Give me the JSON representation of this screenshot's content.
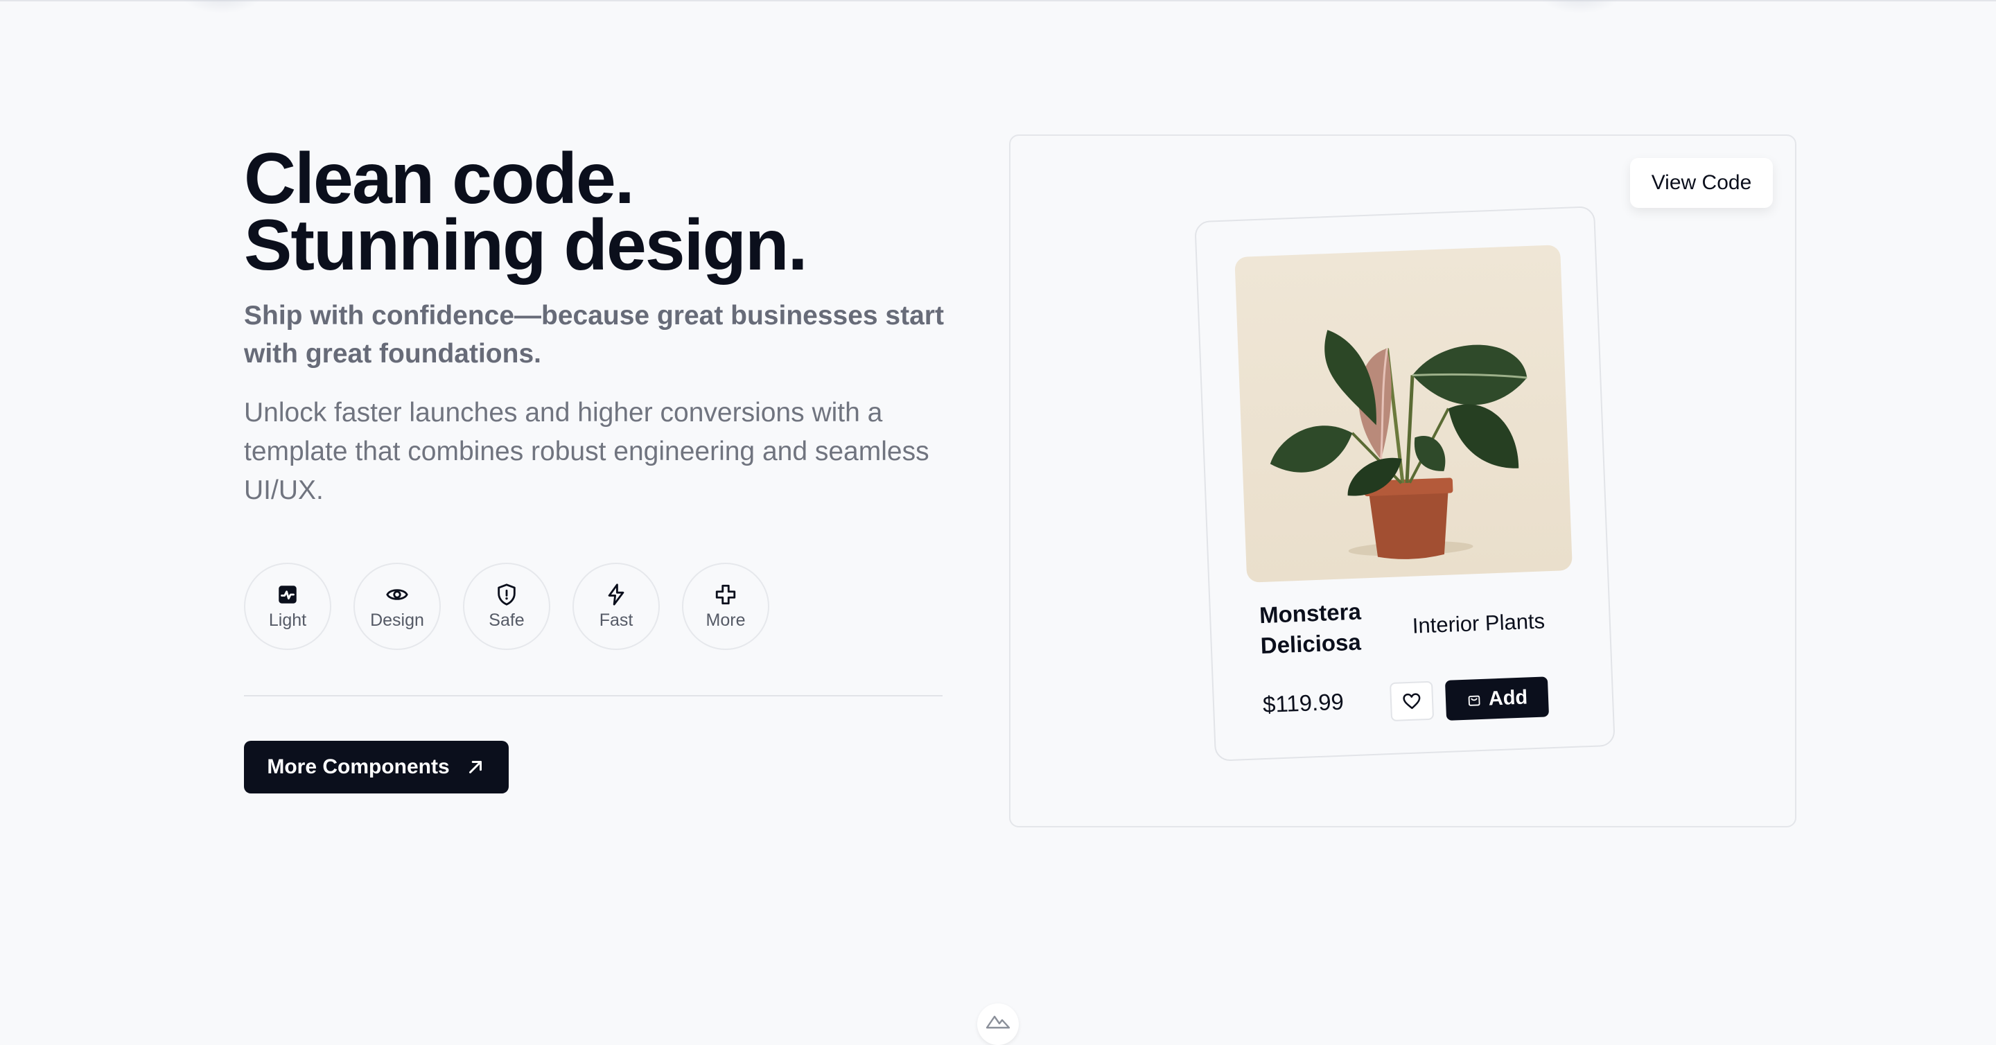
{
  "hero": {
    "headline": "Clean code. Stunning design.",
    "subheadline": "Ship with confidence—because great businesses start with great foundations.",
    "body": "Unlock faster launches and higher conversions with a template that combines robust engineering and seamless UI/UX."
  },
  "features": [
    {
      "label": "Light",
      "icon": "activity-square-icon"
    },
    {
      "label": "Design",
      "icon": "eye-icon"
    },
    {
      "label": "Safe",
      "icon": "shield-icon"
    },
    {
      "label": "Fast",
      "icon": "lightning-icon"
    },
    {
      "label": "More",
      "icon": "plus-icon"
    }
  ],
  "cta": {
    "label": "More Components",
    "icon": "arrow-up-right-icon"
  },
  "preview": {
    "view_code_label": "View Code",
    "product": {
      "name": "Monstera Deliciosa",
      "category": "Interior Plants",
      "price": "$119.99",
      "add_label": "Add"
    }
  },
  "colors": {
    "background": "#f8f9fb",
    "primary": "#0b0f1c",
    "muted": "#676b78"
  }
}
